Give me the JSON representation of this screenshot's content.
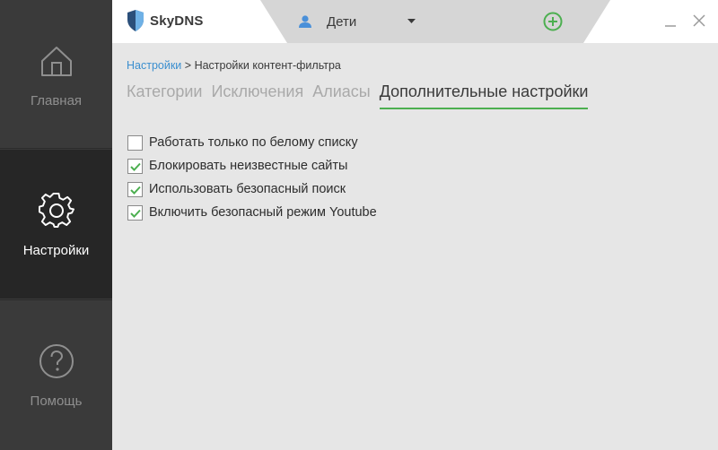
{
  "app": {
    "name": "SkyDNS"
  },
  "sidebar": {
    "items": [
      {
        "label": "Главная",
        "icon": "home-icon",
        "active": false
      },
      {
        "label": "Настройки",
        "icon": "gear-icon",
        "active": true
      },
      {
        "label": "Помощь",
        "icon": "help-icon",
        "active": false
      }
    ]
  },
  "header": {
    "profile": {
      "name": "Дети",
      "icon": "user-icon"
    },
    "add_icon": "plus-circle-icon",
    "window_controls": [
      "minimize-icon",
      "close-icon"
    ]
  },
  "breadcrumb": {
    "root": "Настройки",
    "separator": ">",
    "current": "Настройки контент-фильтра"
  },
  "tabs": [
    {
      "label": "Категории",
      "active": false
    },
    {
      "label": "Исключения",
      "active": false
    },
    {
      "label": "Алиасы",
      "active": false
    },
    {
      "label": "Дополнительные настройки",
      "active": true
    }
  ],
  "options": [
    {
      "label": "Работать только по белому списку",
      "checked": false
    },
    {
      "label": "Блокировать неизвестные сайты",
      "checked": true
    },
    {
      "label": "Использовать безопасный поиск",
      "checked": true
    },
    {
      "label": "Включить безопасный режим Youtube",
      "checked": true
    }
  ],
  "colors": {
    "accent_green": "#4caf50",
    "link_blue": "#3b8fcf",
    "sidebar_bg": "#3a3a3a",
    "sidebar_active_bg": "#262626"
  }
}
